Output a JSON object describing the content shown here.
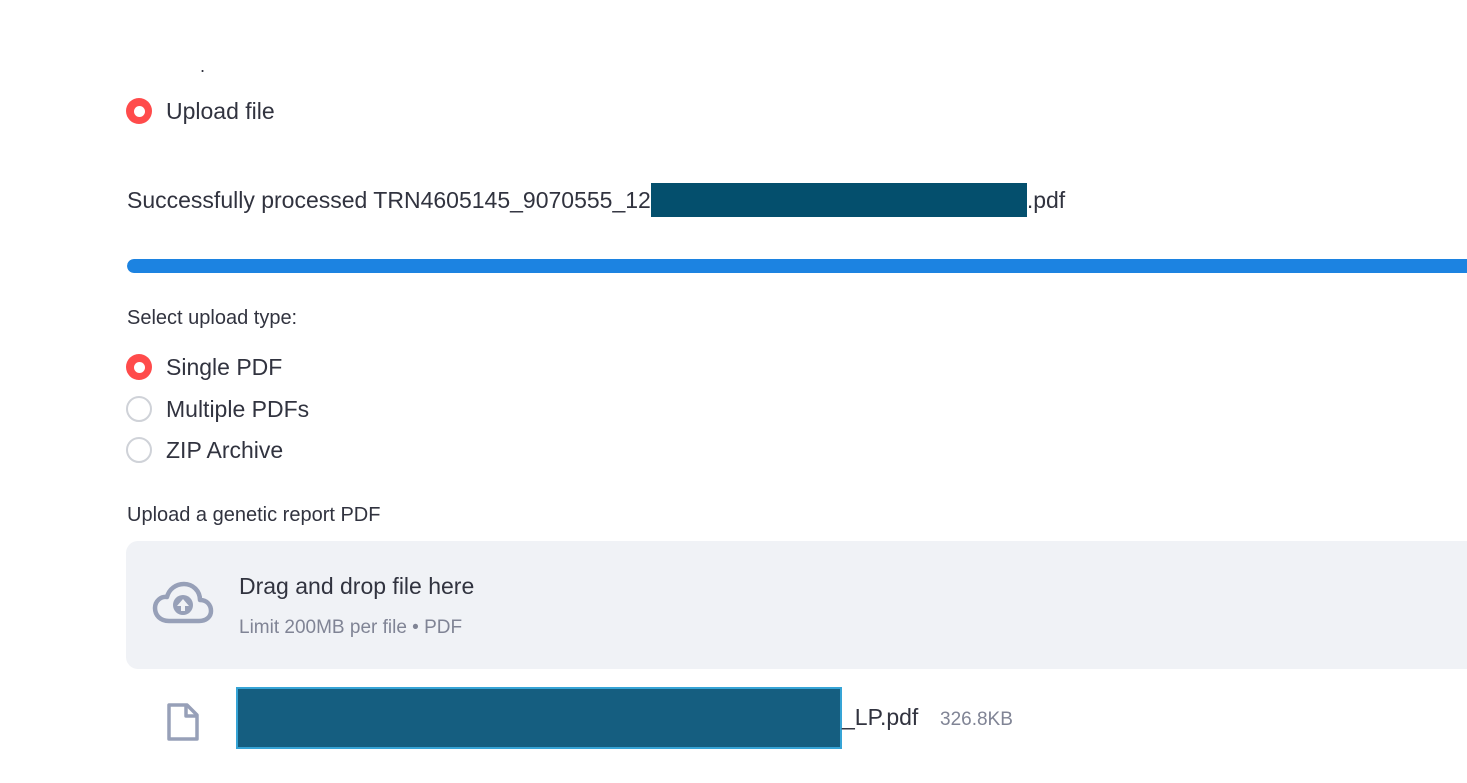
{
  "source_radio": {
    "options": [
      {
        "label": "Upload file",
        "checked": true
      }
    ]
  },
  "status": {
    "prefix": "Successfully processed TRN4605145_9070555_12",
    "suffix": ".pdf"
  },
  "progress": {
    "percent": 100,
    "color": "#1c83e1"
  },
  "upload_type": {
    "label": "Select upload type:",
    "options": [
      {
        "label": "Single PDF",
        "checked": true
      },
      {
        "label": "Multiple PDFs",
        "checked": false
      },
      {
        "label": "ZIP Archive",
        "checked": false
      }
    ]
  },
  "uploader": {
    "label": "Upload a genetic report PDF",
    "drop_title": "Drag and drop file here",
    "drop_subtitle": "Limit 200MB per file • PDF",
    "icon": "cloud-upload-icon"
  },
  "uploaded_file": {
    "name_tail": "_LP.pdf",
    "size": "326.8KB",
    "icon": "file-icon"
  },
  "colors": {
    "accent": "#ff4b4b",
    "redaction": "#044f6d"
  }
}
